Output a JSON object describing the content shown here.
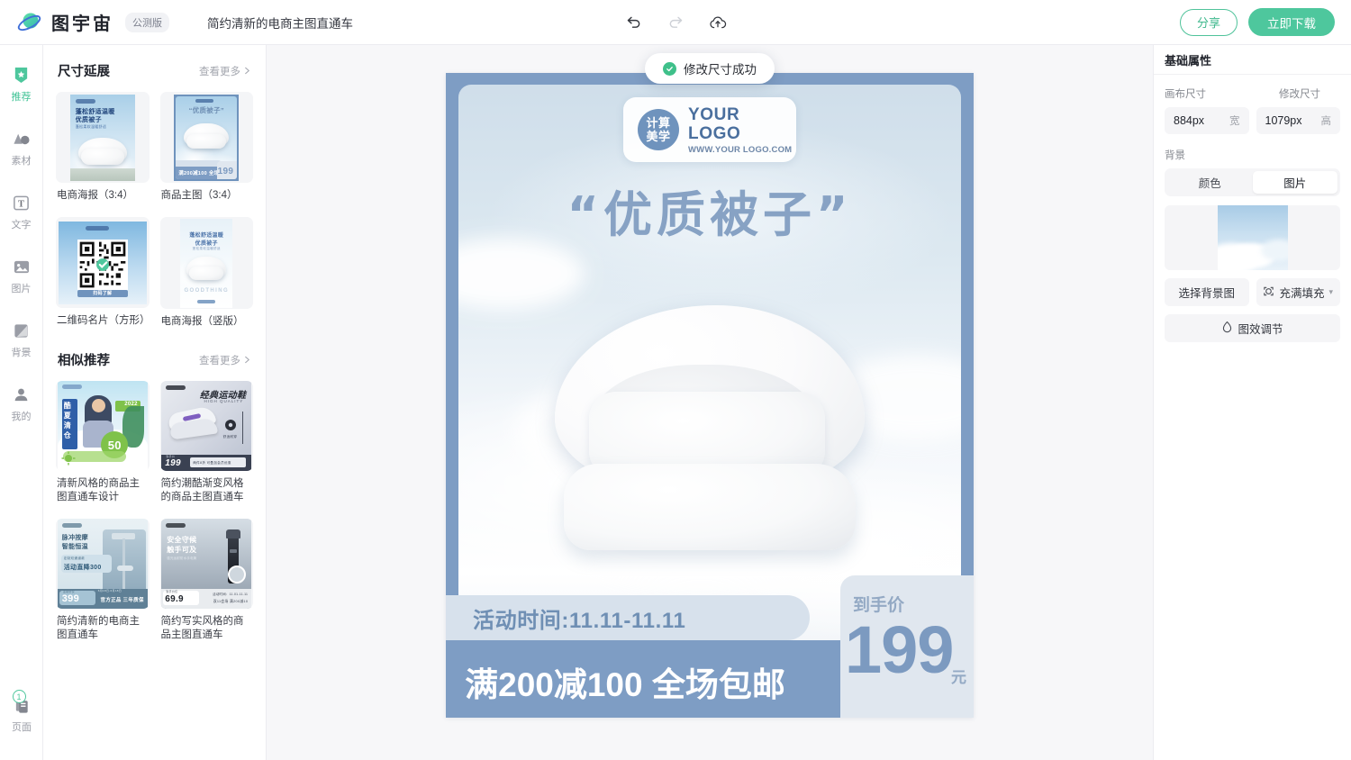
{
  "topbar": {
    "brand_name": "图宇宙",
    "beta_tag": "公测版",
    "doc_title": "简约清新的电商主图直通车",
    "undo_icon": "undo-icon",
    "redo_icon": "redo-icon",
    "upload_icon": "upload-cloud-icon",
    "share_label": "分享",
    "download_label": "立即下载"
  },
  "rail": {
    "items": [
      {
        "label": "推荐",
        "icon": "recommend-badge-icon",
        "active": true
      },
      {
        "label": "素材",
        "icon": "material-shapes-icon",
        "active": false
      },
      {
        "label": "文字",
        "icon": "text-box-icon",
        "active": false
      },
      {
        "label": "图片",
        "icon": "image-icon",
        "active": false
      },
      {
        "label": "背景",
        "icon": "background-icon",
        "active": false
      },
      {
        "label": "我的",
        "icon": "user-icon",
        "active": false
      }
    ],
    "bottom": {
      "label": "页面",
      "icon": "pages-icon",
      "badge": "1"
    }
  },
  "panel": {
    "sections": [
      {
        "title": "尺寸延展",
        "more_label": "查看更多",
        "cards": [
          {
            "label": "电商海报（3:4）",
            "thumb": "quilt-poster-3x4",
            "headline": "蓬松舒适温暖",
            "subline": "优质被子"
          },
          {
            "label": "商品主图（3:4）",
            "thumb": "quilt-main-3x4",
            "headline": "“优质被子”",
            "price": "199"
          },
          {
            "label": "二维码名片（方形）",
            "thumb": "qrcode-card-square",
            "caption": "扫码了解"
          },
          {
            "label": "电商海报（竖版）",
            "thumb": "quilt-poster-vertical",
            "headline": "蓬松舒适温暖",
            "subline": "优质被子"
          }
        ]
      },
      {
        "title": "相似推荐",
        "more_label": "查看更多",
        "cards": [
          {
            "label": "清新风格的商品主图直通车设计",
            "thumb": "summer-sale-model",
            "headline": "酷夏清仓",
            "badge": "50",
            "year": "2022"
          },
          {
            "label": "简约潮酷渐变风格的商品主图直通车",
            "thumb": "sneaker-promo",
            "headline": "经典运动鞋",
            "subline": "HIGH QUALITY",
            "price": "199"
          },
          {
            "label": "简约清新的电商主图直通车",
            "thumb": "shower-promo",
            "headline": "脉冲按摩 智能恒温",
            "tag": "活动直降300",
            "price": "399"
          },
          {
            "label": "简约写实风格的商品主图直通车",
            "thumb": "flashlight-promo",
            "headline": "安全守候 触手可及",
            "price": "69.9"
          }
        ]
      }
    ]
  },
  "canvas": {
    "toast": {
      "text": "修改尺寸成功",
      "icon": "check-circle-icon"
    },
    "logo": {
      "circle_line1": "计算",
      "circle_line2": "美学",
      "name": "YOUR LOGO",
      "url": "WWW.YOUR LOGO.COM"
    },
    "headline": "“优质被子”",
    "time_text": "活动时间:11.11-11.11",
    "promo_text": "满200减100 全场包邮",
    "price_label": "到手价",
    "price_number": "199",
    "price_unit": "元",
    "accent_border": "#7e9dc4",
    "headline_color": "#87a2c4"
  },
  "props": {
    "title": "基础属性",
    "canvas_size_label": "画布尺寸",
    "modify_size_label": "修改尺寸",
    "width_value": "884px",
    "width_unit": "宽",
    "height_value": "1079px",
    "height_unit": "高",
    "background_label": "背景",
    "seg_color": "颜色",
    "seg_image": "图片",
    "seg_active": "图片",
    "choose_bg_label": "选择背景图",
    "fill_mode_label": "充满填充",
    "fill_mode_icon": "fill-frame-icon",
    "effect_label": "图效调节",
    "effect_icon": "droplet-icon"
  }
}
